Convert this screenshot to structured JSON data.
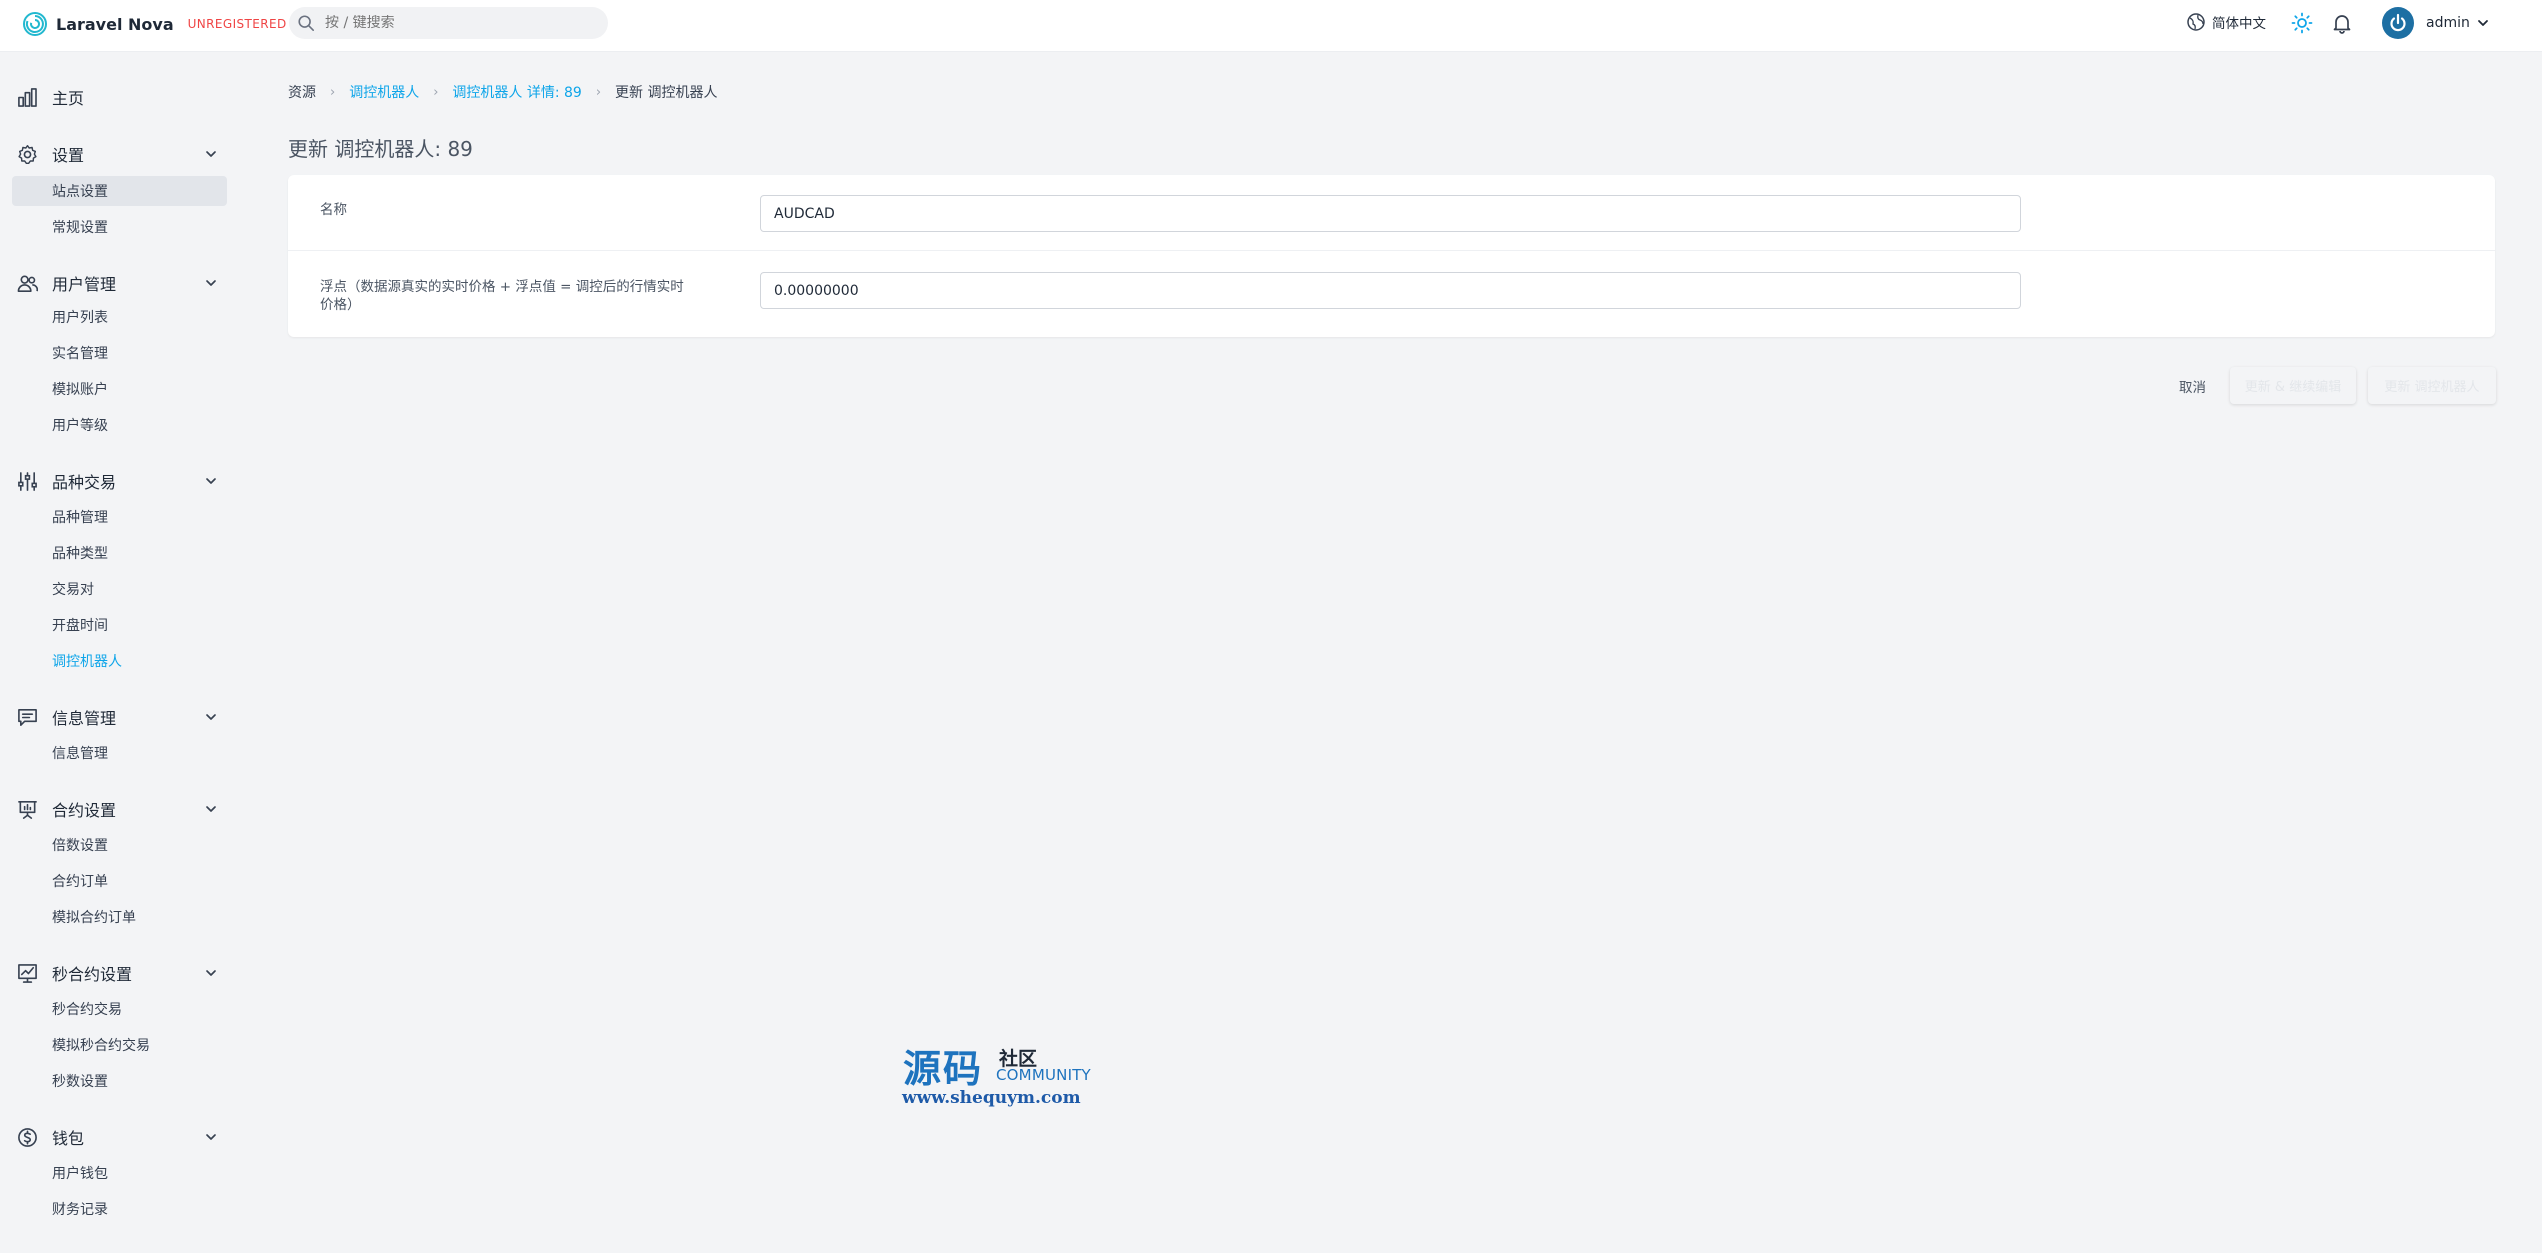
{
  "header": {
    "app_name": "Laravel Nova",
    "badge": "UNREGISTERED",
    "search_placeholder": "按 / 键搜索",
    "language": "简体中文",
    "user_name": "admin"
  },
  "sidebar": {
    "home": "主页",
    "groups": [
      {
        "label": "设置",
        "items": [
          "站点设置",
          "常规设置"
        ]
      },
      {
        "label": "用户管理",
        "items": [
          "用户列表",
          "实名管理",
          "模拟账户",
          "用户等级"
        ]
      },
      {
        "label": "品种交易",
        "items": [
          "品种管理",
          "品种类型",
          "交易对",
          "开盘时间",
          "调控机器人"
        ]
      },
      {
        "label": "信息管理",
        "items": [
          "信息管理"
        ]
      },
      {
        "label": "合约设置",
        "items": [
          "倍数设置",
          "合约订单",
          "模拟合约订单"
        ]
      },
      {
        "label": "秒合约设置",
        "items": [
          "秒合约交易",
          "模拟秒合约交易",
          "秒数设置"
        ]
      },
      {
        "label": "钱包",
        "items": [
          "用户钱包",
          "财务记录"
        ]
      }
    ]
  },
  "breadcrumb": {
    "root": "资源",
    "resource": "调控机器人",
    "detail": "调控机器人 详情: 89",
    "current": "更新 调控机器人"
  },
  "page_title": "更新 调控机器人: 89",
  "form": {
    "name_label": "名称",
    "name_value": "AUDCAD",
    "float_label_line1": "浮点（数据源真实的实时价格 + 浮点值 = 调控后的行情实时",
    "float_label_line2": "价格）",
    "float_value": "0.00000000"
  },
  "actions": {
    "cancel": "取消",
    "update_continue": "更新 & 继续编辑",
    "update": "更新 调控机器人"
  },
  "watermark": {
    "big": "源码",
    "small": "社区",
    "community": "COMMUNITY",
    "url": "www.shequym.com"
  },
  "colors": {
    "accent": "#0ea5e9",
    "badge": "#ef4444",
    "avatar": "#1d6fa3"
  }
}
